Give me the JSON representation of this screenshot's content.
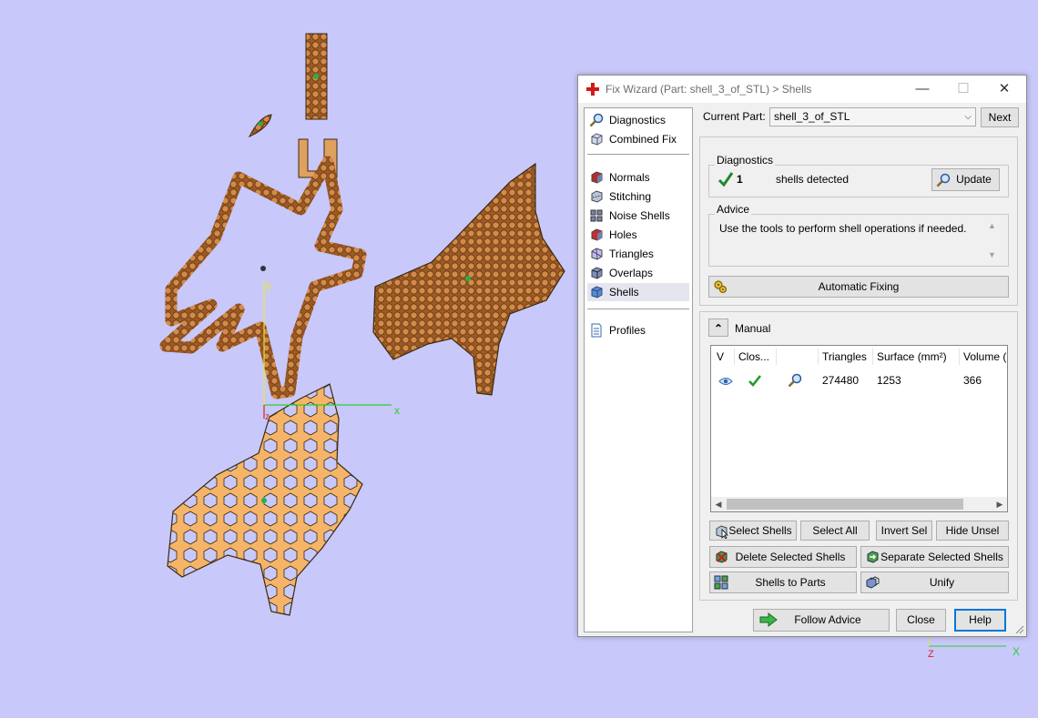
{
  "window": {
    "title": "Fix Wizard (Part: shell_3_of_STL) > Shells",
    "minimize_glyph": "—",
    "maximize_glyph": "☐",
    "close_glyph": "✕"
  },
  "nav": {
    "items": [
      {
        "label": "Diagnostics",
        "icon": "magnifier-icon"
      },
      {
        "label": "Combined Fix",
        "icon": "cube-icon"
      },
      {
        "label": "Normals",
        "icon": "normals-icon"
      },
      {
        "label": "Stitching",
        "icon": "stitching-icon"
      },
      {
        "label": "Noise Shells",
        "icon": "noise-shells-icon"
      },
      {
        "label": "Holes",
        "icon": "holes-icon"
      },
      {
        "label": "Triangles",
        "icon": "triangles-icon"
      },
      {
        "label": "Overlaps",
        "icon": "overlaps-icon"
      },
      {
        "label": "Shells",
        "icon": "shells-icon",
        "selected": true
      },
      {
        "label": "Profiles",
        "icon": "document-icon"
      }
    ]
  },
  "current_part": {
    "label": "Current Part:",
    "value": "shell_3_of_STL",
    "next_label": "Next"
  },
  "diagnostics": {
    "group_label": "Diagnostics",
    "count": "1",
    "text": "shells detected",
    "update_label": "Update"
  },
  "advice": {
    "group_label": "Advice",
    "text": "Use the tools to perform shell operations if needed."
  },
  "automatic_fixing_label": "Automatic Fixing",
  "manual": {
    "label": "Manual",
    "collapse_glyph": "⌃",
    "columns": [
      "V",
      "Clos...",
      "",
      "Triangles",
      "Surface (mm²)",
      "Volume ("
    ],
    "rows": [
      {
        "triangles": "274480",
        "surface": "1253",
        "volume": "366"
      }
    ],
    "buttons": {
      "select_shells": "Select Shells",
      "select_all": "Select All",
      "invert_sel": "Invert Sel",
      "hide_unsel": "Hide Unsel",
      "delete_selected": "Delete Selected Shells",
      "separate_selected": "Separate Selected Shells",
      "shells_to_parts": "Shells to Parts",
      "unify": "Unify"
    }
  },
  "footer": {
    "follow_advice": "Follow Advice",
    "close": "Close",
    "help": "Help"
  },
  "viewport": {
    "axis_x": "x",
    "axis_y": "y",
    "axis_z": "z",
    "mini_axis_z": "Z",
    "mini_axis_x": "X"
  },
  "colors": {
    "background": "#c8c8fa",
    "part_dark": "#a8642a",
    "part_light": "#f5b467",
    "accent_blue": "#0078d7"
  }
}
